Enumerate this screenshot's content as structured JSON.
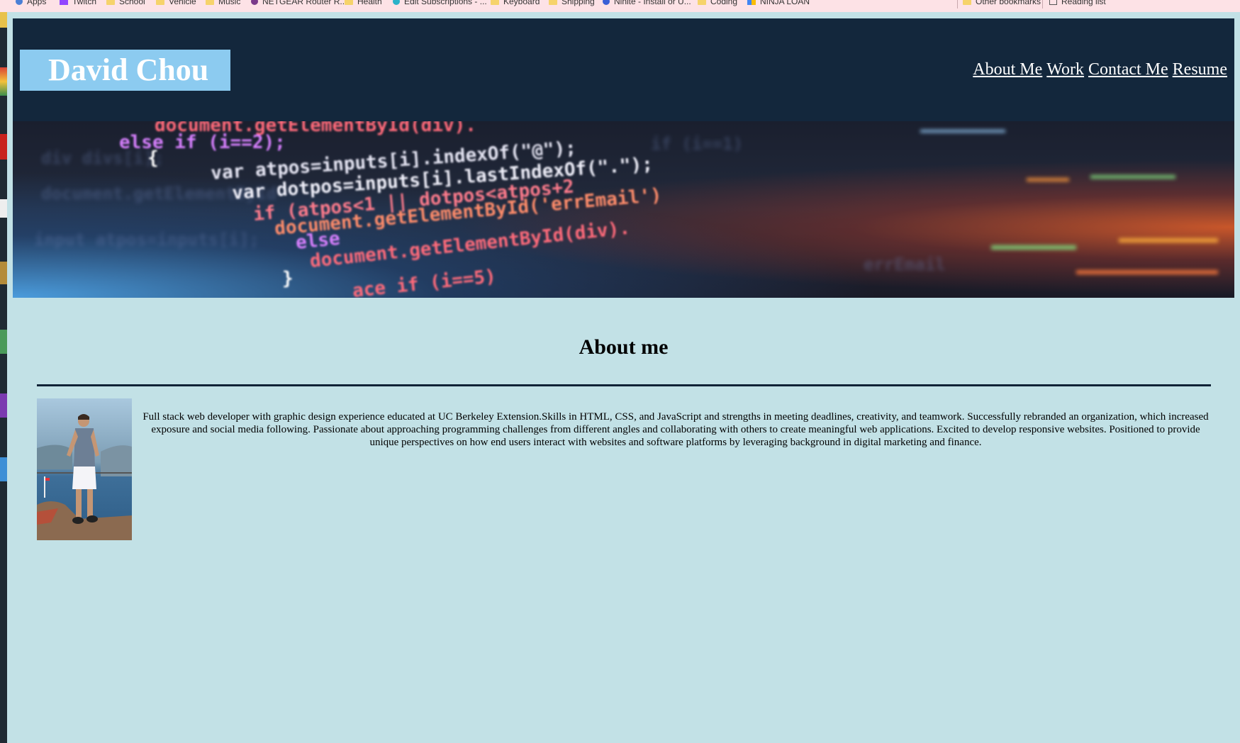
{
  "bookmarks_bar": {
    "items": [
      {
        "label": "Apps"
      },
      {
        "label": "Twitch"
      },
      {
        "label": "School"
      },
      {
        "label": "Vehicle"
      },
      {
        "label": "Music"
      },
      {
        "label": "NETGEAR Router R..."
      },
      {
        "label": "Health"
      },
      {
        "label": "Edit Subscriptions - ..."
      },
      {
        "label": "Keyboard"
      },
      {
        "label": "Shipping"
      },
      {
        "label": "Ninite - Install or U..."
      },
      {
        "label": "Coding"
      },
      {
        "label": "NINJA LOAN"
      }
    ],
    "other_bookmarks": "Other bookmarks",
    "reading_list": "Reading list"
  },
  "header": {
    "logo": "David Chou",
    "nav": [
      "About Me",
      "Work",
      "Contact Me",
      "Resume"
    ]
  },
  "hero": {
    "code_lines": [
      "document.getElementById(div).",
      "else if (i==2);",
      "{",
      "var atpos=inputs[i].indexOf(\"@\");",
      "var dotpos=inputs[i].lastIndexOf(\".\");",
      "if (atpos<1 || dotpos<atpos+2",
      "document.getElementById('errEmail')",
      "else",
      "document.getElementById(div).",
      "}",
      "ace if (i==5)"
    ]
  },
  "about": {
    "title": "About me",
    "bio": "Full stack web developer with graphic design experience educated at UC Berkeley Extension.Skills in HTML, CSS, and JavaScript and strengths in meeting deadlines, creativity, and teamwork. Successfully rebranded an organization, which increased exposure and social media following. Passionate about approaching programming challenges from different angles and collaborating with others to create meaningful web applications. Excited to develop responsive websites. Positioned to provide unique perspectives on how end users interact with websites and software platforms by leveraging background in digital marketing and finance."
  },
  "colors": {
    "header_bg": "#13273c",
    "logo_bg": "#8ccbf0",
    "page_bg": "#c2e1e6",
    "rule": "#0f2236"
  }
}
